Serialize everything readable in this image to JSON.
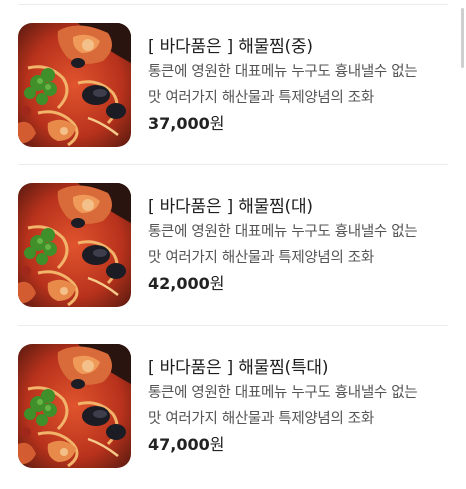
{
  "menu": {
    "items": [
      {
        "title": "[ 바다품은 ] 해물찜(중)",
        "desc_line1": "통큰에 영원한 대표메뉴 누구도 흉내낼수 없는",
        "desc_line2": "맛 여러가지 해산물과 특제양념의 조화",
        "price": "37,000",
        "currency": "원",
        "image": "seafood-stew-photo"
      },
      {
        "title": "[ 바다품은 ] 해물찜(대)",
        "desc_line1": "통큰에 영원한 대표메뉴 누구도 흉내낼수 없는",
        "desc_line2": "맛 여러가지 해산물과 특제양념의 조화",
        "price": "42,000",
        "currency": "원",
        "image": "seafood-stew-photo"
      },
      {
        "title": "[ 바다품은 ] 해물찜(특대)",
        "desc_line1": "통큰에 영원한 대표메뉴 누구도 흉내낼수 없는",
        "desc_line2": "맛 여러가지 해산물과 특제양념의 조화",
        "price": "47,000",
        "currency": "원",
        "image": "seafood-stew-photo"
      }
    ]
  },
  "colors": {
    "title": "#1e1e1e",
    "description": "#555555",
    "price": "#222222",
    "divider": "#ececec"
  }
}
